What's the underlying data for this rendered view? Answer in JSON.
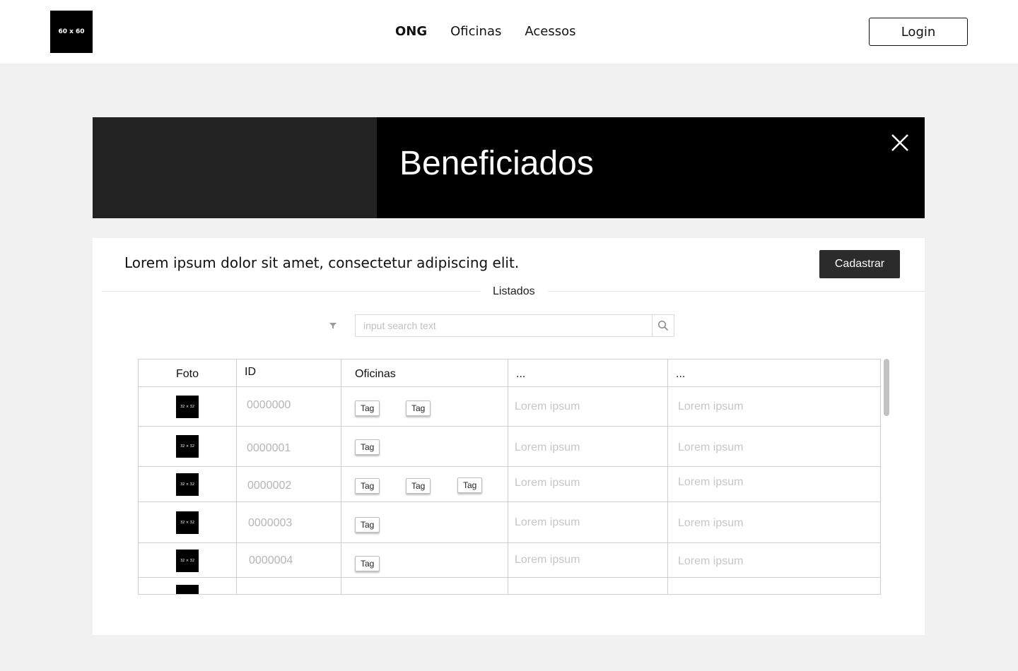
{
  "header": {
    "logo_text": "60 x 60",
    "nav": [
      {
        "label": "ONG",
        "active": true
      },
      {
        "label": "Oficinas",
        "active": false
      },
      {
        "label": "Acessos",
        "active": false
      }
    ],
    "login_label": "Login"
  },
  "banner": {
    "title": "Beneficiados"
  },
  "card": {
    "description": "Lorem ipsum dolor sit amet, consectetur adipiscing elit.",
    "cadastrar_label": "Cadastrar",
    "divider_label": "Listados",
    "search": {
      "placeholder": "input search text"
    }
  },
  "table": {
    "headers": [
      "Foto",
      "ID",
      "Oficinas",
      "...",
      "..."
    ],
    "thumb_text": "32 × 32",
    "rows": [
      {
        "id": "0000000",
        "tags": [
          "Tag",
          "Tag"
        ],
        "col4": "Lorem ipsum",
        "col5": "Lorem ipsum"
      },
      {
        "id": "0000001",
        "tags": [
          "Tag"
        ],
        "col4": "Lorem ipsum",
        "col5": "Lorem ipsum"
      },
      {
        "id": "0000002",
        "tags": [
          "Tag",
          "Tag",
          "Tag"
        ],
        "col4": "Lorem ipsum",
        "col5": "Lorem ipsum"
      },
      {
        "id": "0000003",
        "tags": [
          "Tag"
        ],
        "col4": "Lorem ipsum",
        "col5": "Lorem ipsum"
      },
      {
        "id": "0000004",
        "tags": [
          "Tag"
        ],
        "col4": "Lorem ipsum",
        "col5": "Lorem ipsum"
      }
    ]
  }
}
